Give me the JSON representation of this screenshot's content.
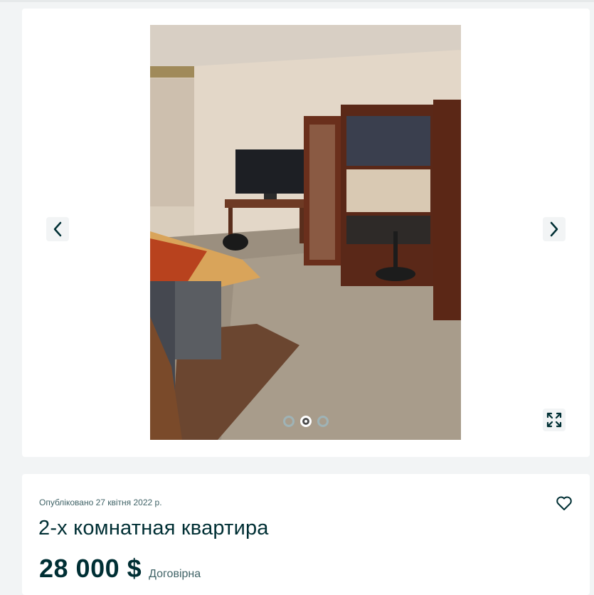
{
  "gallery": {
    "photo_alt": "",
    "slide_count": 3,
    "active_slide": 2,
    "prev_icon": "chevron-left-icon",
    "next_icon": "chevron-right-icon",
    "fullscreen_icon": "expand-icon"
  },
  "listing": {
    "published": "Опубліковано 27 квітня 2022 р.",
    "title": "2-х комнатная квартира",
    "price": "28 000 $",
    "negotiable": "Договірна",
    "favorite_icon": "heart-icon"
  },
  "colors": {
    "accent": "#002f34",
    "background": "#f2f4f5",
    "card": "#ffffff"
  }
}
